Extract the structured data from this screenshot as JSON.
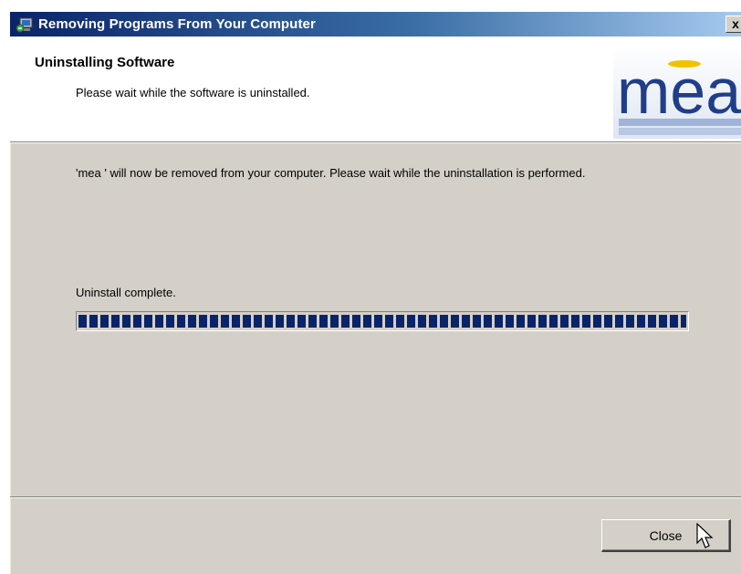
{
  "window": {
    "title": "Removing Programs From Your Computer",
    "close_glyph": "x"
  },
  "header": {
    "title": "Uninstalling Software",
    "subtitle": "Please wait while the software is uninstalled."
  },
  "logo": {
    "text": "mea",
    "accent_color": "#f2c200",
    "brand_color": "#1f3d8a"
  },
  "main": {
    "message": "'mea ' will now be removed from your computer. Please wait while the uninstallation is performed.",
    "status": "Uninstall complete.",
    "progress_percent": 100
  },
  "footer": {
    "close_label": "Close"
  },
  "colors": {
    "progress": "#0a246a",
    "dialog_bg": "#d4d0c8"
  }
}
